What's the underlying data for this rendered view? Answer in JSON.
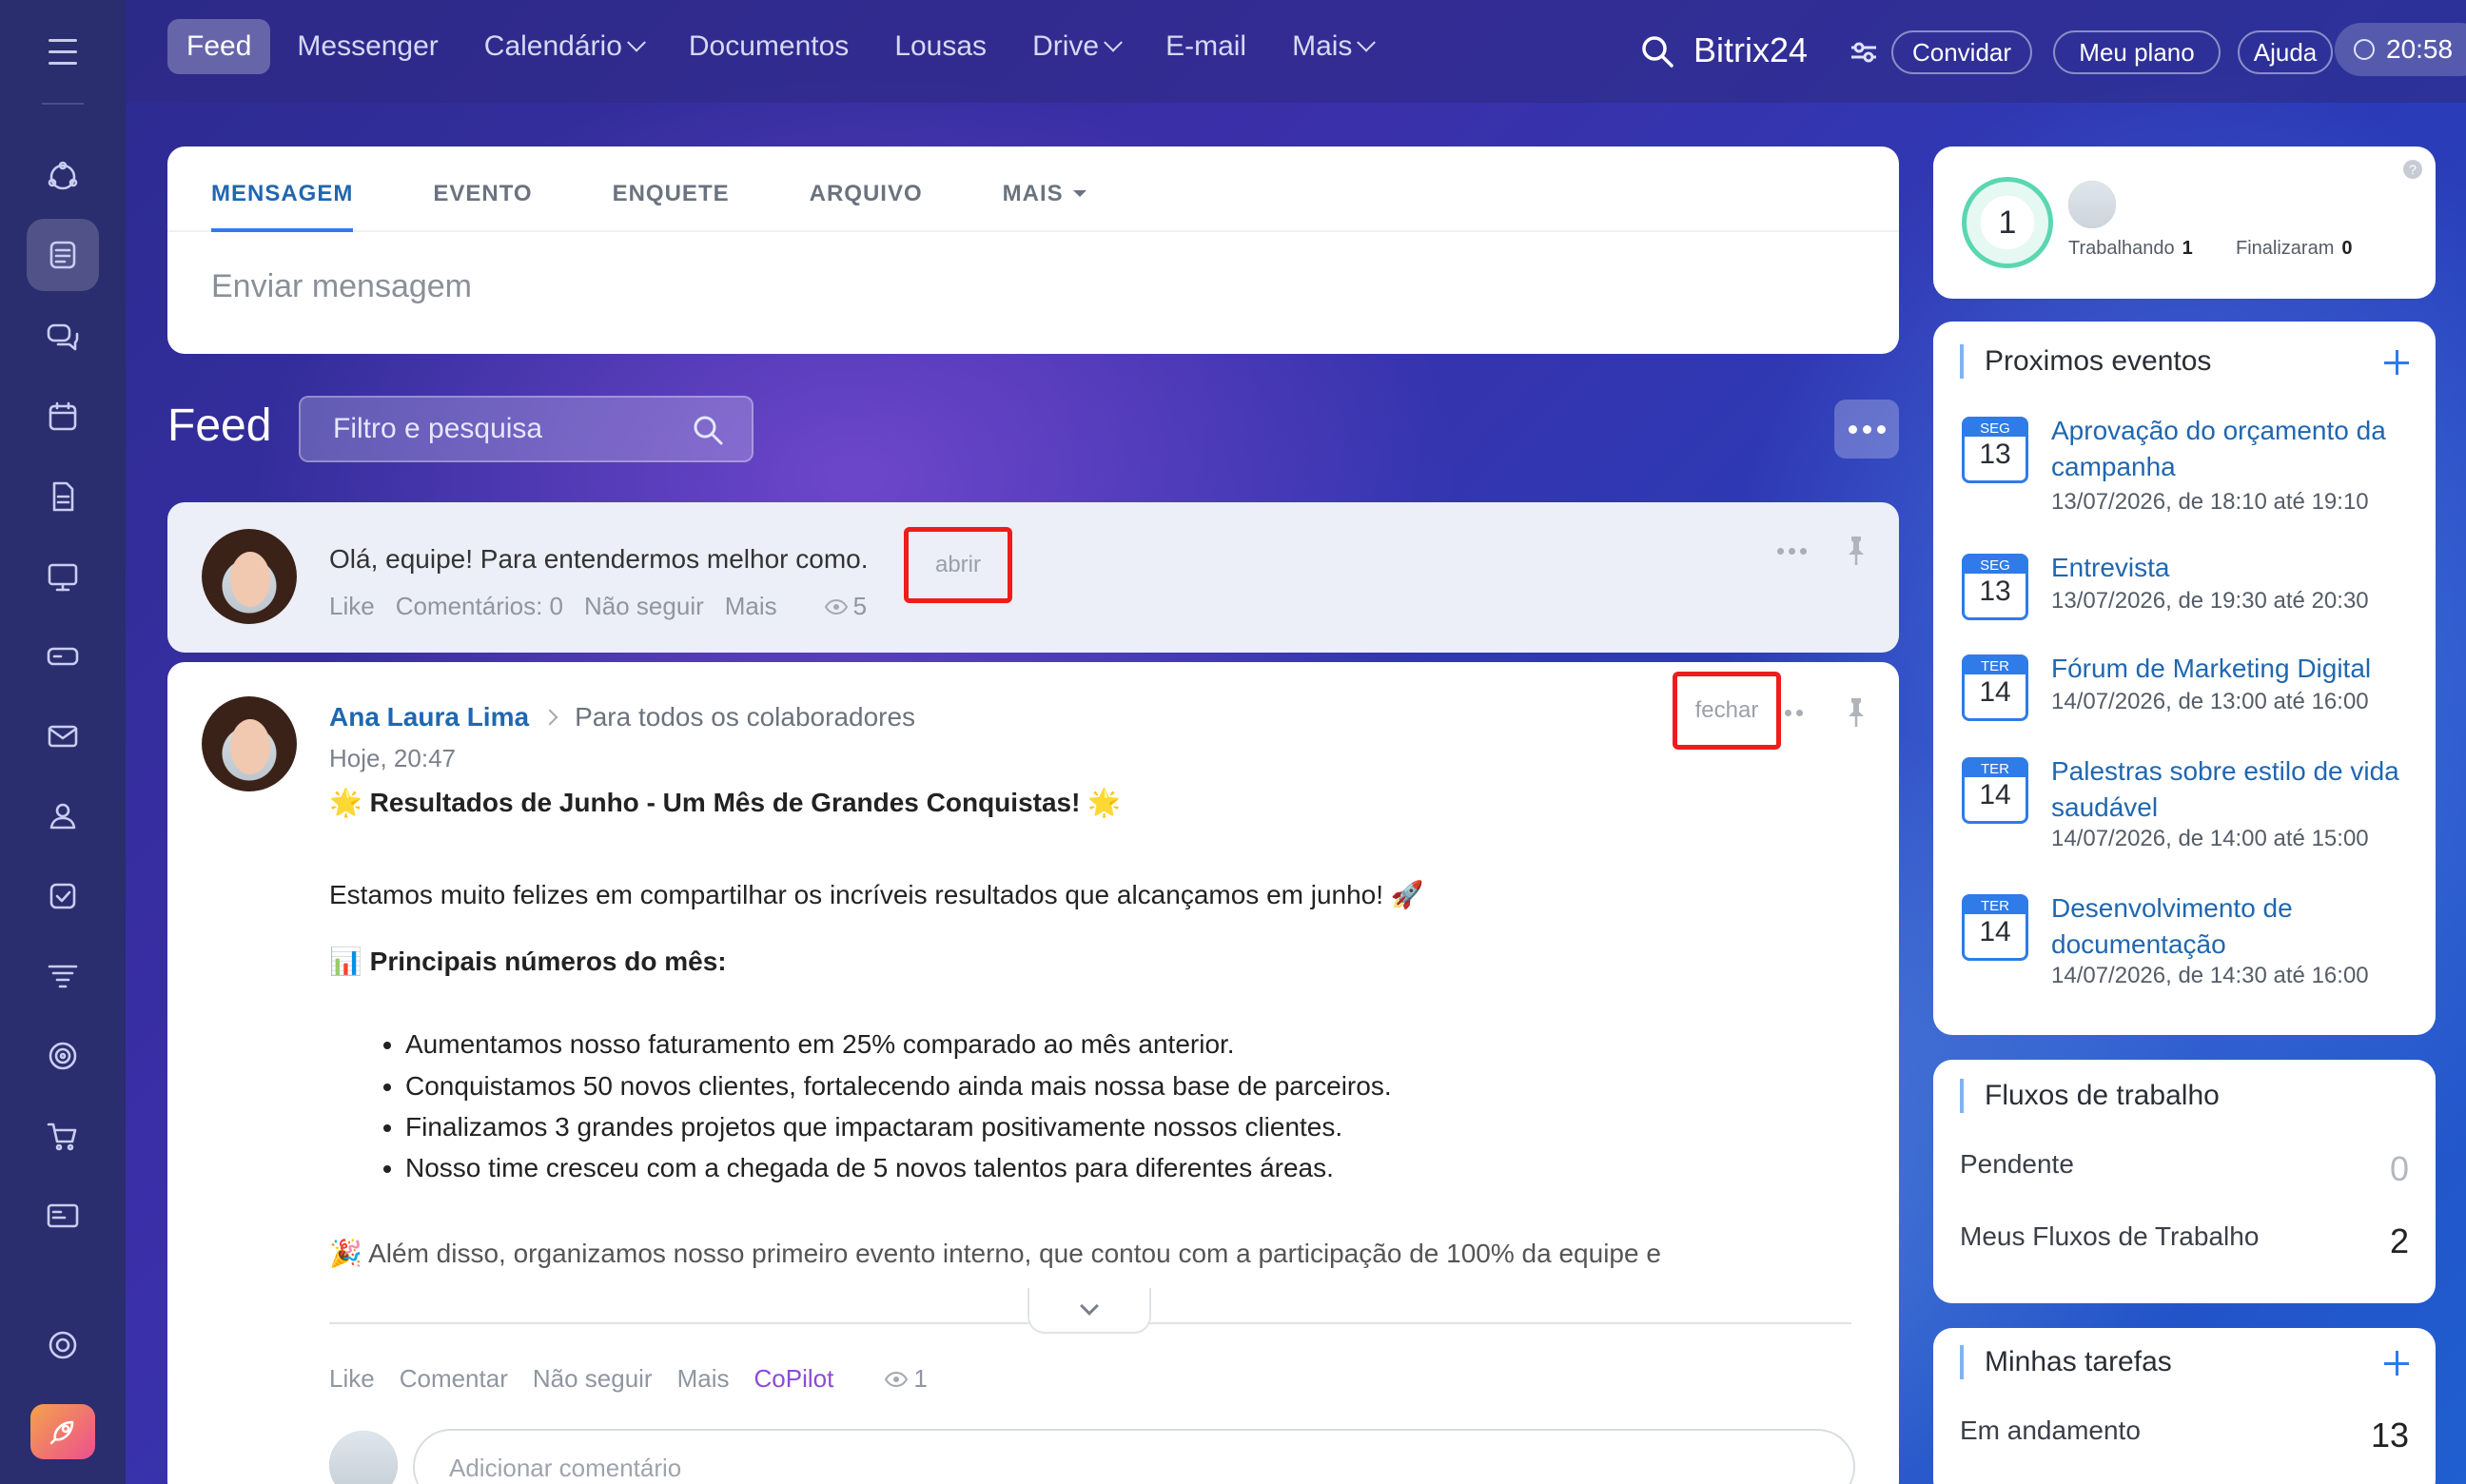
{
  "topbar": {
    "nav": [
      {
        "label": "Feed",
        "active": true,
        "dropdown": false
      },
      {
        "label": "Messenger",
        "active": false,
        "dropdown": false
      },
      {
        "label": "Calendário",
        "active": false,
        "dropdown": true
      },
      {
        "label": "Documentos",
        "active": false,
        "dropdown": false
      },
      {
        "label": "Lousas",
        "active": false,
        "dropdown": false
      },
      {
        "label": "Drive",
        "active": false,
        "dropdown": true
      },
      {
        "label": "E-mail",
        "active": false,
        "dropdown": false
      },
      {
        "label": "Mais",
        "active": false,
        "dropdown": true
      }
    ],
    "brand": "Bitrix24",
    "invite": "Convidar",
    "my_plan": "Meu plano",
    "help": "Ajuda",
    "time": "20:58"
  },
  "sidebar": {
    "icons": [
      "menu-icon",
      "activity-icon",
      "feed-icon",
      "chat-icon",
      "calendar-icon",
      "document-icon",
      "board-icon",
      "drive-icon",
      "mail-icon",
      "contacts-icon",
      "tasks-icon",
      "funnel-icon",
      "target-icon",
      "cart-icon",
      "card-icon",
      "settings-icon",
      "rocket-icon"
    ]
  },
  "composer": {
    "tabs": [
      "MENSAGEM",
      "EVENTO",
      "ENQUETE",
      "ARQUIVO",
      "MAIS"
    ],
    "placeholder": "Enviar mensagem"
  },
  "feed": {
    "title": "Feed",
    "filter_placeholder": "Filtro e pesquisa"
  },
  "collapsed_post": {
    "text": "Olá, equipe! Para entendermos melhor como.",
    "open_label": "abrir",
    "like": "Like",
    "comments": "Comentários: 0",
    "unfollow": "Não seguir",
    "more": "Mais",
    "views": "5"
  },
  "post": {
    "author": "Ana Laura Lima",
    "destination": "Para todos os colaboradores",
    "time": "Hoje, 20:47",
    "close_label": "fechar",
    "headline": "🌟 Resultados de Junho - Um Mês de Grandes Conquistas! 🌟",
    "intro": "Estamos muito felizes em compartilhar os incríveis resultados que alcançamos em junho! 🚀",
    "numbers_title": "📊 Principais números do mês:",
    "bullets": [
      "Aumentamos nosso faturamento em 25% comparado ao mês anterior.",
      "Conquistamos 50 novos clientes, fortalecendo ainda mais nossa base de parceiros.",
      "Finalizamos 3 grandes projetos que impactaram positivamente nossos clientes.",
      "Nosso time cresceu com a chegada de 5 novos talentos para diferentes áreas."
    ],
    "extra": "🎉 Além disso, organizamos nosso primeiro evento interno, que contou com a participação de 100% da equipe e",
    "actions": {
      "like": "Like",
      "comment": "Comentar",
      "unfollow": "Não seguir",
      "more": "Mais",
      "copilot": "CoPilot",
      "views": "1"
    },
    "comment_placeholder": "Adicionar comentário"
  },
  "timeman": {
    "count": "1",
    "working_label": "Trabalhando",
    "working_count": "1",
    "finished_label": "Finalizaram",
    "finished_count": "0",
    "help": "?"
  },
  "events": {
    "title": "Proximos eventos",
    "items": [
      {
        "dow": "SEG",
        "day": "13",
        "title": "Aprovação do orçamento da campanha",
        "date": "13/07/2026, de 18:10 até 19:10"
      },
      {
        "dow": "SEG",
        "day": "13",
        "title": "Entrevista",
        "date": "13/07/2026, de 19:30 até 20:30"
      },
      {
        "dow": "TER",
        "day": "14",
        "title": "Fórum de Marketing Digital",
        "date": "14/07/2026, de 13:00 até 16:00"
      },
      {
        "dow": "TER",
        "day": "14",
        "title": "Palestras sobre estilo de vida saudável",
        "date": "14/07/2026, de 14:00 até 15:00"
      },
      {
        "dow": "TER",
        "day": "14",
        "title": "Desenvolvimento de documentação",
        "date": "14/07/2026, de 14:30 até 16:00"
      }
    ]
  },
  "workflows": {
    "title": "Fluxos de trabalho",
    "pending_label": "Pendente",
    "pending_count": "0",
    "mine_label": "Meus Fluxos de Trabalho",
    "mine_count": "2"
  },
  "tasks": {
    "title": "Minhas tarefas",
    "in_progress_label": "Em andamento",
    "in_progress_count": "13"
  },
  "colors": {
    "accent": "#2f7be8",
    "link": "#2067b0",
    "highlight": "#ee1c1c",
    "copilot": "#8d4ad7"
  }
}
